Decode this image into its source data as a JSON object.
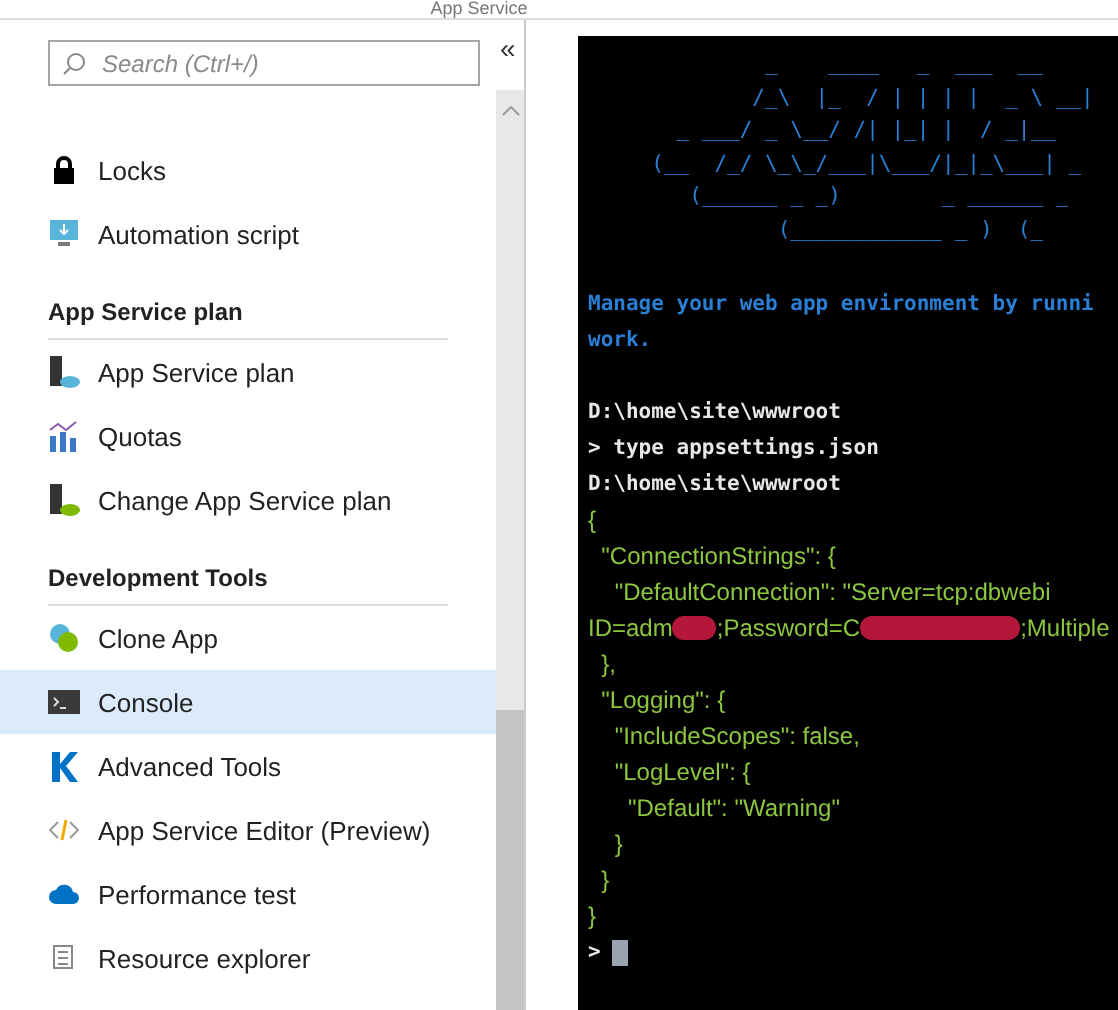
{
  "header": {
    "title": "App Service"
  },
  "sidebar": {
    "search": {
      "placeholder": "Search (Ctrl+/)"
    },
    "collapse": "«",
    "sections": [
      {
        "items": [
          {
            "label": "Locks",
            "selected": false
          },
          {
            "label": "Automation script",
            "selected": false
          }
        ]
      },
      {
        "heading": "App Service plan",
        "items": [
          {
            "label": "App Service plan",
            "selected": false
          },
          {
            "label": "Quotas",
            "selected": false
          },
          {
            "label": "Change App Service plan",
            "selected": false
          }
        ]
      },
      {
        "heading": "Development Tools",
        "items": [
          {
            "label": "Clone App",
            "selected": false
          },
          {
            "label": "Console",
            "selected": true
          },
          {
            "label": "Advanced Tools",
            "selected": false
          },
          {
            "label": "App Service Editor (Preview)",
            "selected": false
          },
          {
            "label": "Performance test",
            "selected": false
          },
          {
            "label": "Resource explorer",
            "selected": false
          }
        ]
      }
    ]
  },
  "console": {
    "ascii_art": [
      "              _    ____   _  ___  __",
      "             /_\\  |_  / | | | |  _ \\ __|",
      "       _ ___/ _ \\__/ /| |_| |  / _|__",
      "     (__  /_/ \\_\\_/___|\\___/|_|_\\___| _",
      "        (______ _ _)        _ ______ _",
      "               (____________ _ )  (_"
    ],
    "message": [
      "Manage your web app environment by runni",
      "work."
    ],
    "lines": [
      {
        "kind": "output",
        "text": "D:\\home\\site\\wwwroot"
      },
      {
        "kind": "output",
        "text": "> type appsettings.json"
      },
      {
        "kind": "output",
        "text": "D:\\home\\site\\wwwroot"
      },
      {
        "kind": "json",
        "text": "{"
      },
      {
        "kind": "json",
        "text": "  \"ConnectionStrings\": {"
      },
      {
        "kind": "json",
        "text": "    \"DefaultConnection\": \"Server=tcp:dbwebi"
      },
      {
        "kind": "redacted",
        "parts": [
          "ID=adm",
          ";Password=C",
          ";Multiple"
        ]
      },
      {
        "kind": "json",
        "text": "  },"
      },
      {
        "kind": "json",
        "text": "  \"Logging\": {"
      },
      {
        "kind": "json",
        "text": "    \"IncludeScopes\": false,"
      },
      {
        "kind": "json",
        "text": "    \"LogLevel\": {"
      },
      {
        "kind": "json",
        "text": "      \"Default\": \"Warning\""
      },
      {
        "kind": "json",
        "text": "    }"
      },
      {
        "kind": "json",
        "text": "  }"
      },
      {
        "kind": "json",
        "text": "}"
      },
      {
        "kind": "prompt",
        "text": ">"
      }
    ]
  }
}
